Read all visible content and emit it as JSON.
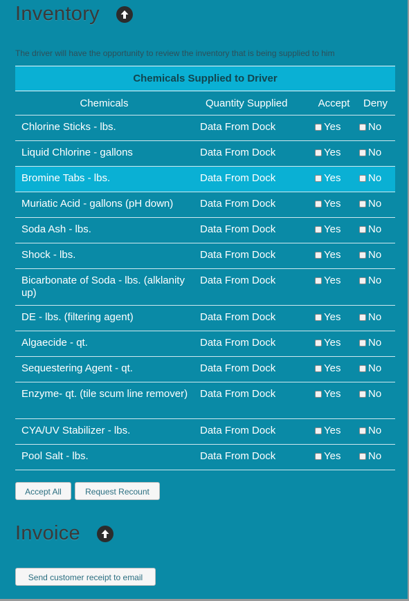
{
  "inventory": {
    "title": "Inventory",
    "description": "The driver will have the opportunity to review the inventory that is being supplied to him",
    "table": {
      "caption": "Chemicals Supplied to Driver",
      "columns": {
        "chemicals": "Chemicals",
        "quantity": "Quantity Supplied",
        "accept": "Accept",
        "deny": "Deny"
      },
      "accept_label": "Yes",
      "deny_label": "No",
      "rows": [
        {
          "name": "Chlorine Sticks - lbs.",
          "quantity": "Data From Dock"
        },
        {
          "name": "Liquid Chlorine - gallons",
          "quantity": "Data From Dock"
        },
        {
          "name": "Bromine Tabs - lbs.",
          "quantity": "Data From Dock"
        },
        {
          "name": "Muriatic Acid - gallons (pH down)",
          "quantity": "Data From Dock"
        },
        {
          "name": "Soda Ash - lbs.",
          "quantity": "Data From Dock"
        },
        {
          "name": "Shock - lbs.",
          "quantity": "Data From Dock"
        },
        {
          "name": "Bicarbonate of Soda - lbs. (alklanity up)",
          "quantity": "Data From Dock"
        },
        {
          "name": "DE - lbs. (filtering agent)",
          "quantity": "Data From Dock"
        },
        {
          "name": "Algaecide - qt.",
          "quantity": "Data From Dock"
        },
        {
          "name": "Sequestering Agent - qt.",
          "quantity": "Data From Dock"
        },
        {
          "name": "Enzyme- qt. (tile scum line remover)",
          "quantity": "Data From Dock"
        },
        {
          "name": "CYA/UV Stabilizer - lbs.",
          "quantity": "Data From Dock"
        },
        {
          "name": "Pool Salt - lbs.",
          "quantity": "Data From Dock"
        }
      ]
    },
    "buttons": {
      "accept_all": "Accept All",
      "request_recount": "Request Recount"
    }
  },
  "invoice": {
    "title": "Invoice",
    "send_receipt": "Send customer receipt to email"
  },
  "colors": {
    "page_bg": "#0a8aa6",
    "highlight_row": "#0ab0d4",
    "title_text": "#3a3a3a"
  },
  "icons": {
    "section_toggle": "arrow-up-circle-icon"
  }
}
